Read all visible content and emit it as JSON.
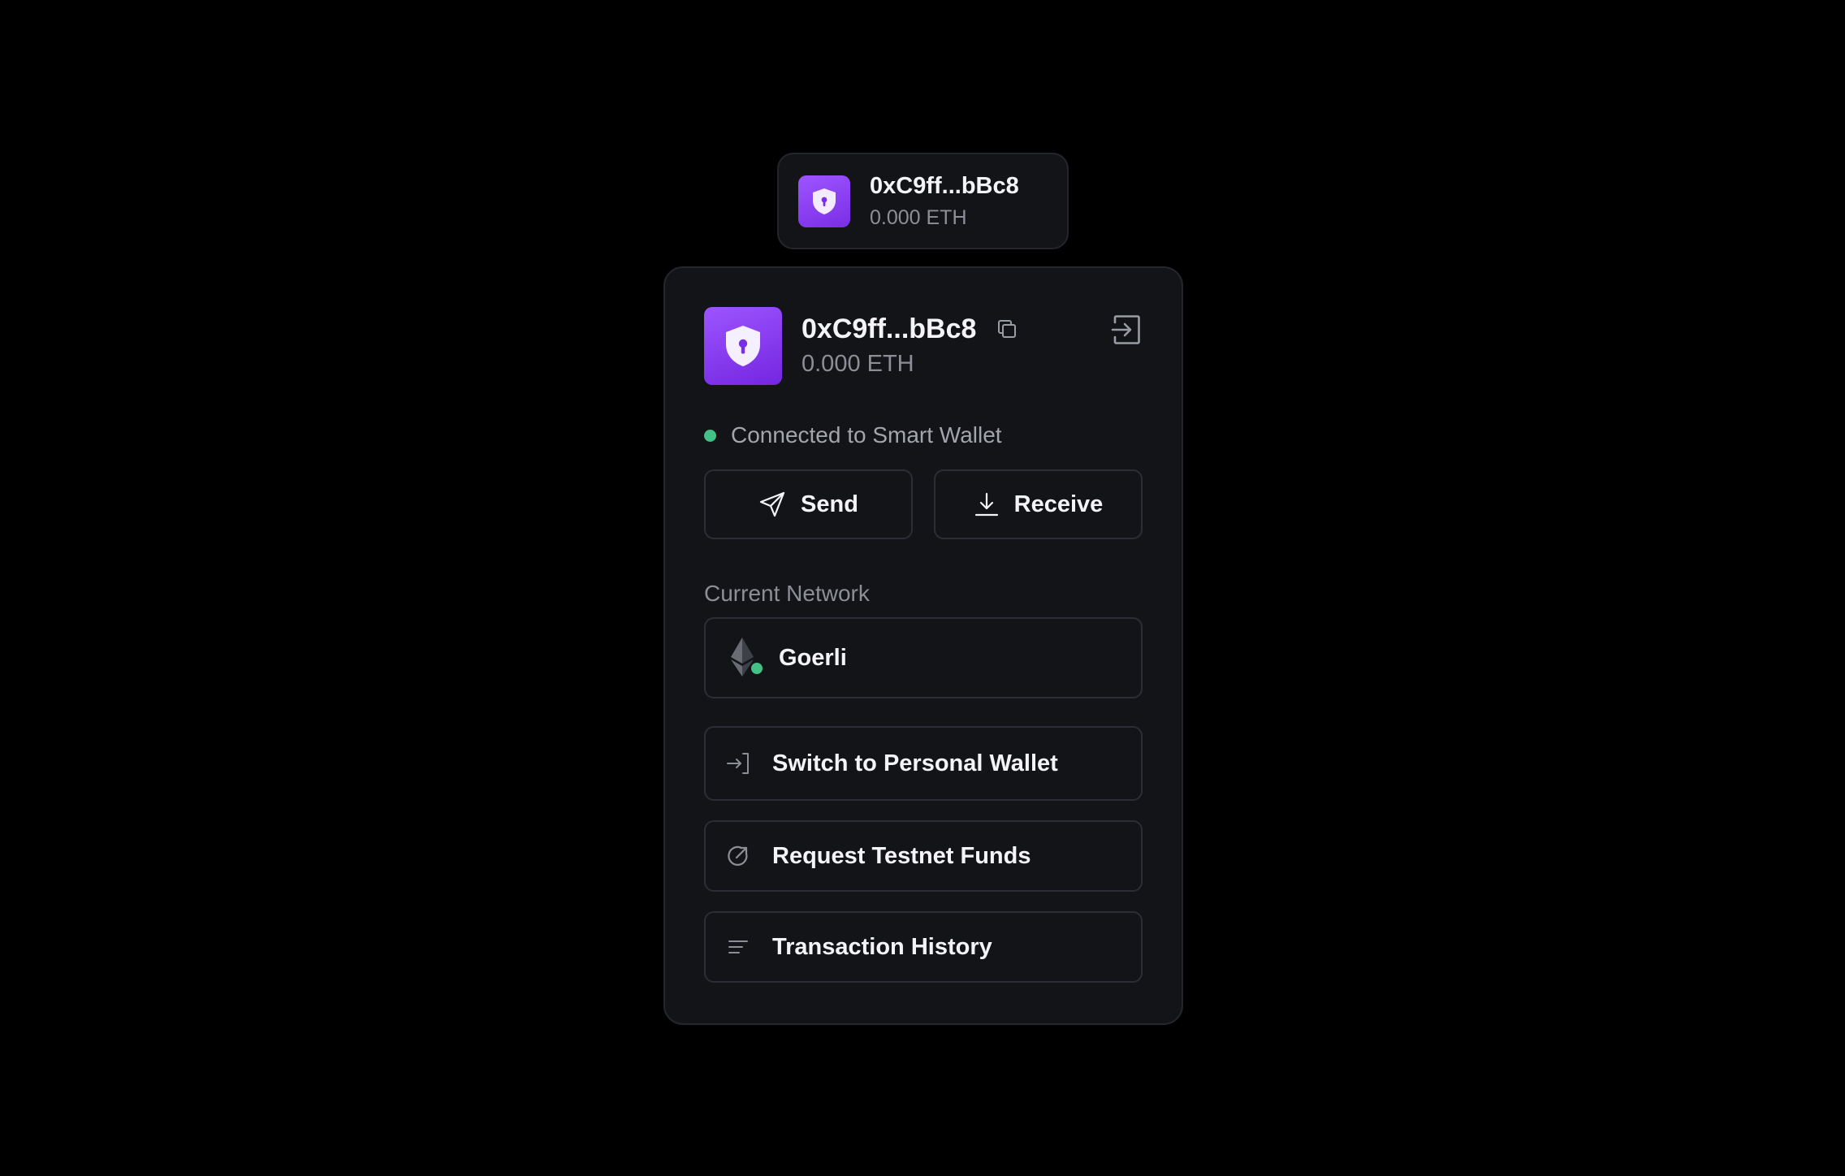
{
  "chip": {
    "address": "0xC9ff...bBc8",
    "balance": "0.000 ETH",
    "avatar_icon": "shield-lock-icon"
  },
  "panel": {
    "address": "0xC9ff...bBc8",
    "balance": "0.000 ETH",
    "avatar_icon": "shield-lock-icon",
    "copy_icon": "copy-icon",
    "disconnect_icon": "exit-icon",
    "status": {
      "text": "Connected to Smart Wallet",
      "color": "#43c085"
    },
    "actions": {
      "send_label": "Send",
      "send_icon": "send-icon",
      "receive_label": "Receive",
      "receive_icon": "download-icon"
    },
    "network": {
      "section_label": "Current Network",
      "name": "Goerli",
      "icon": "ethereum-icon"
    },
    "menu": [
      {
        "label": "Switch to Personal Wallet",
        "icon": "switch-icon"
      },
      {
        "label": "Request Testnet Funds",
        "icon": "faucet-icon"
      },
      {
        "label": "Transaction History",
        "icon": "list-icon"
      }
    ]
  },
  "colors": {
    "background": "#000000",
    "surface": "#131418",
    "border": "#2c2e35",
    "accent_purple": "#8b3ff5",
    "success_green": "#43c085",
    "text_primary": "#f4f4f6",
    "text_secondary": "#8d8f97"
  }
}
